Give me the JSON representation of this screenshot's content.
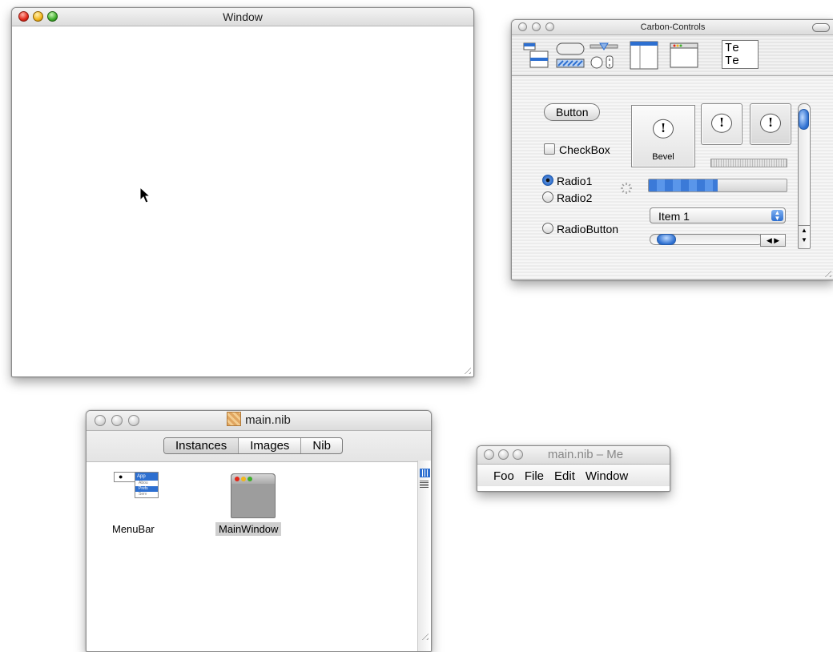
{
  "window_main": {
    "title": "Window"
  },
  "carbon": {
    "title": "Carbon-Controls",
    "toolbar_text_icon_line1": "Te",
    "toolbar_text_icon_line2": "Te",
    "button_label": "Button",
    "checkbox_label": "CheckBox",
    "bevel_label": "Bevel",
    "radio1_label": "Radio1",
    "radio2_label": "Radio2",
    "radiobutton_label": "RadioButton",
    "popup_value": "Item 1",
    "progress_fraction": 0.5
  },
  "nib": {
    "title": "main.nib",
    "tabs": [
      "Instances",
      "Images",
      "Nib"
    ],
    "selected_tab": "Instances",
    "menubar_label": "MenuBar",
    "menubar_preview_items": [
      "App",
      "Abou",
      "Prefs",
      "Serv"
    ],
    "mainwindow_label": "MainWindow"
  },
  "menu_editor": {
    "title": "main.nib – Me",
    "items": [
      "Foo",
      "File",
      "Edit",
      "Window"
    ]
  },
  "colors": {
    "accent": "#2d6fd0",
    "close": "#e2281a",
    "minimize": "#f2b51c",
    "zoom": "#3fae2c"
  }
}
